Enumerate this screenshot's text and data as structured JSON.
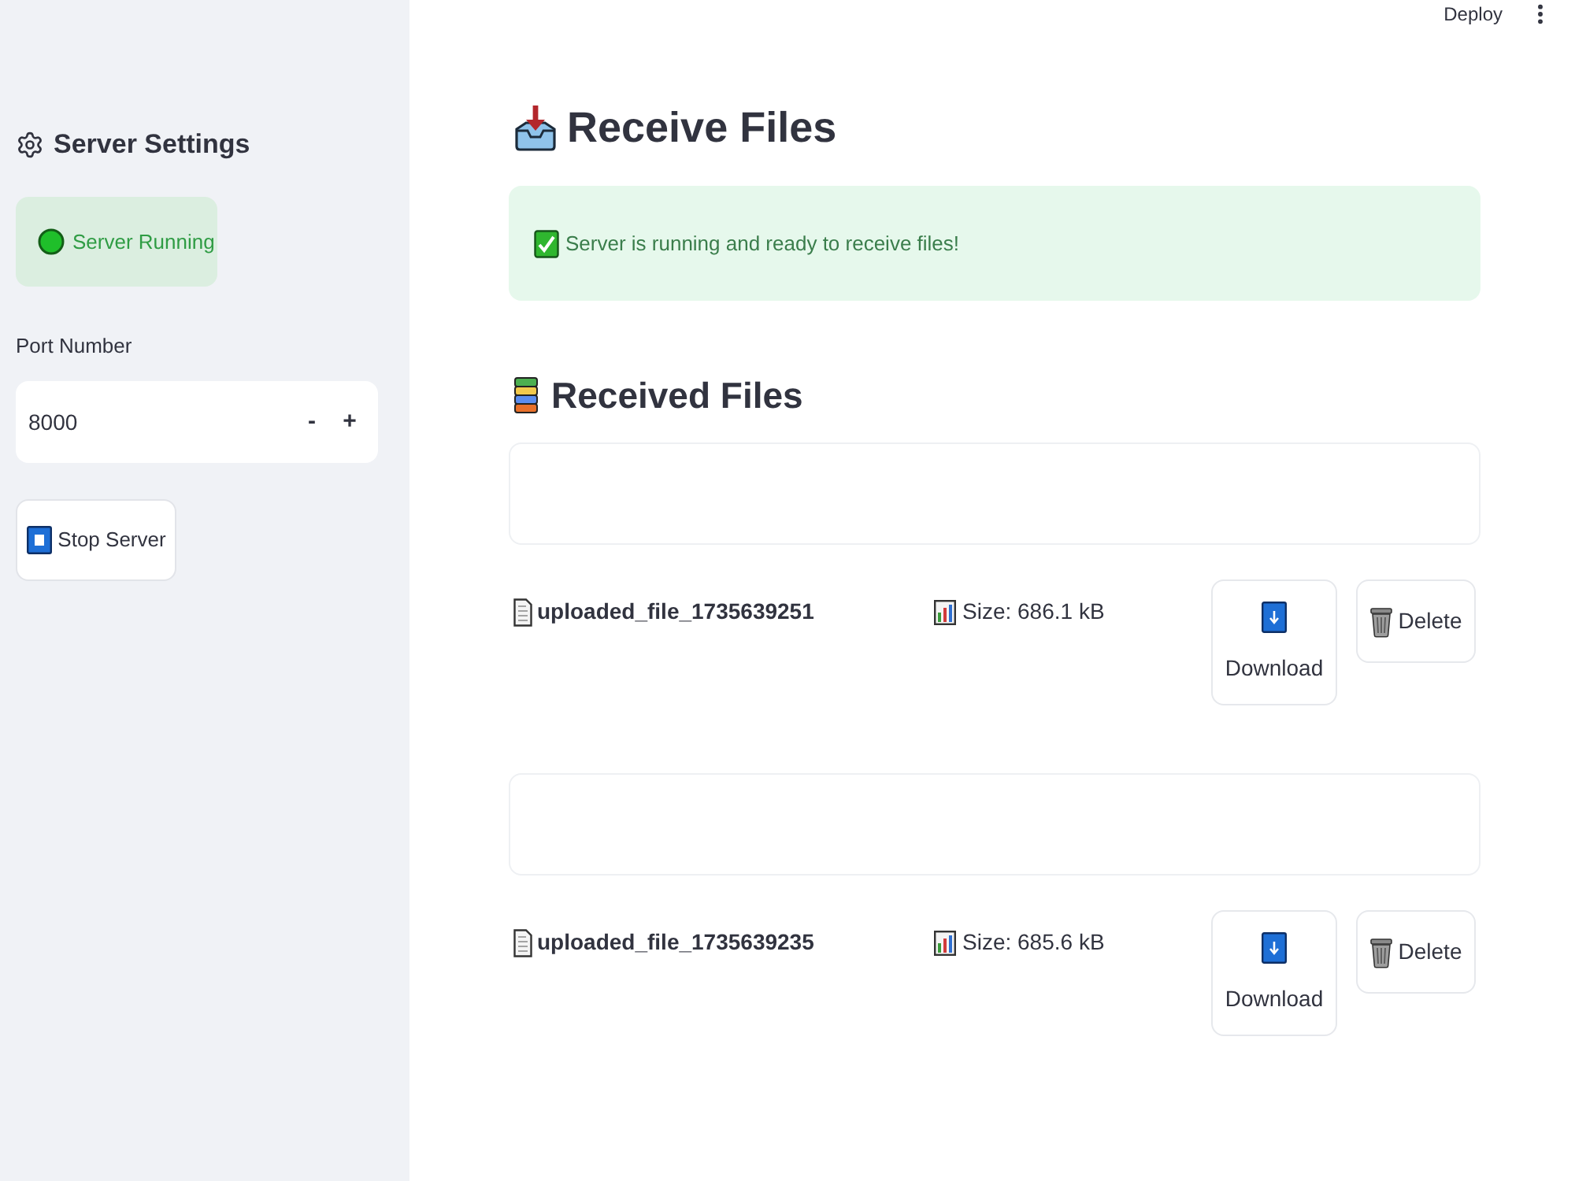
{
  "header": {
    "deploy": "Deploy"
  },
  "sidebar": {
    "title": "Server Settings",
    "status": {
      "label": "Server Running",
      "running": true
    },
    "port": {
      "label": "Port Number",
      "value": "8000",
      "decrement": "-",
      "increment": "+"
    },
    "stop_button": "Stop Server"
  },
  "main": {
    "title": "Receive Files",
    "alert": "Server is running and ready to receive files!",
    "section_title": "Received Files",
    "files": [
      {
        "name": "uploaded_file_1735639251",
        "size": "Size: 686.1 kB",
        "download": "Download",
        "delete": "Delete"
      },
      {
        "name": "uploaded_file_1735639235",
        "size": "Size: 685.6 kB",
        "download": "Download",
        "delete": "Delete"
      }
    ]
  }
}
